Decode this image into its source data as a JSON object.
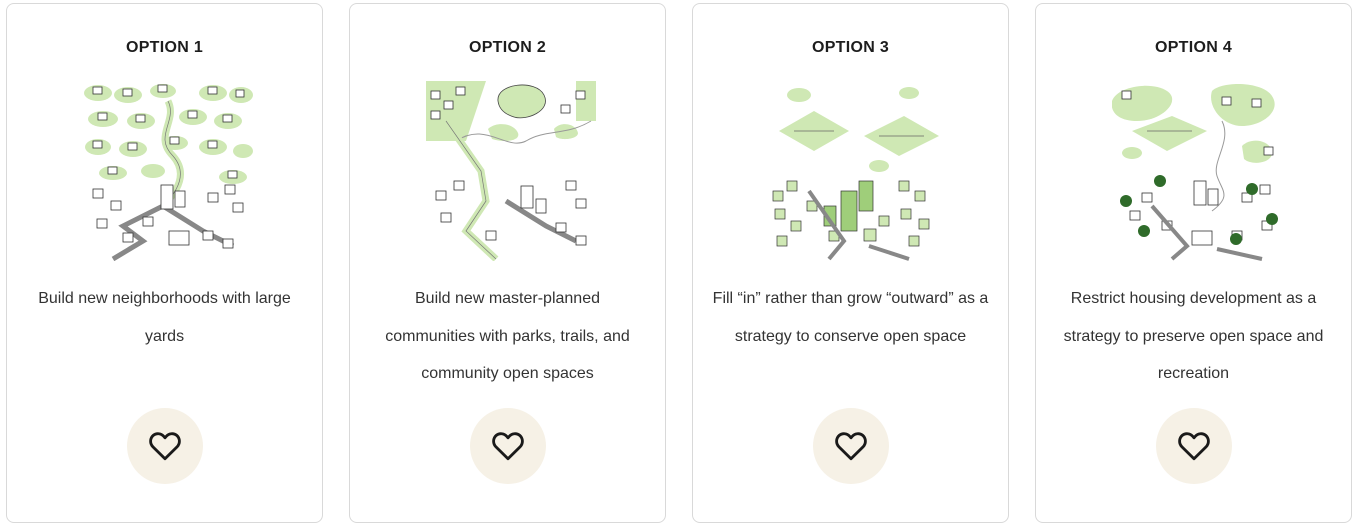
{
  "options": [
    {
      "title": "OPTION 1",
      "description": "Build new neighborhoods with large yards",
      "illustration": "suburban-neighborhood-illustration"
    },
    {
      "title": "OPTION 2",
      "description": "Build new master-planned communities with parks, trails, and community open spaces",
      "illustration": "master-planned-community-illustration"
    },
    {
      "title": "OPTION 3",
      "description": "Fill “in” rather than grow “outward” as a strategy to conserve open space",
      "illustration": "infill-development-illustration"
    },
    {
      "title": "OPTION 4",
      "description": "Restrict housing development as a strategy to preserve open space and recreation",
      "illustration": "restricted-development-illustration"
    }
  ],
  "like_icon": "heart-outline-icon",
  "colors": {
    "card_border": "#d9d9d9",
    "like_button_bg": "#f6f1e6",
    "green_light": "#cfe8b4",
    "green_mid": "#9fce7a",
    "green_dark": "#2f6b2a"
  }
}
